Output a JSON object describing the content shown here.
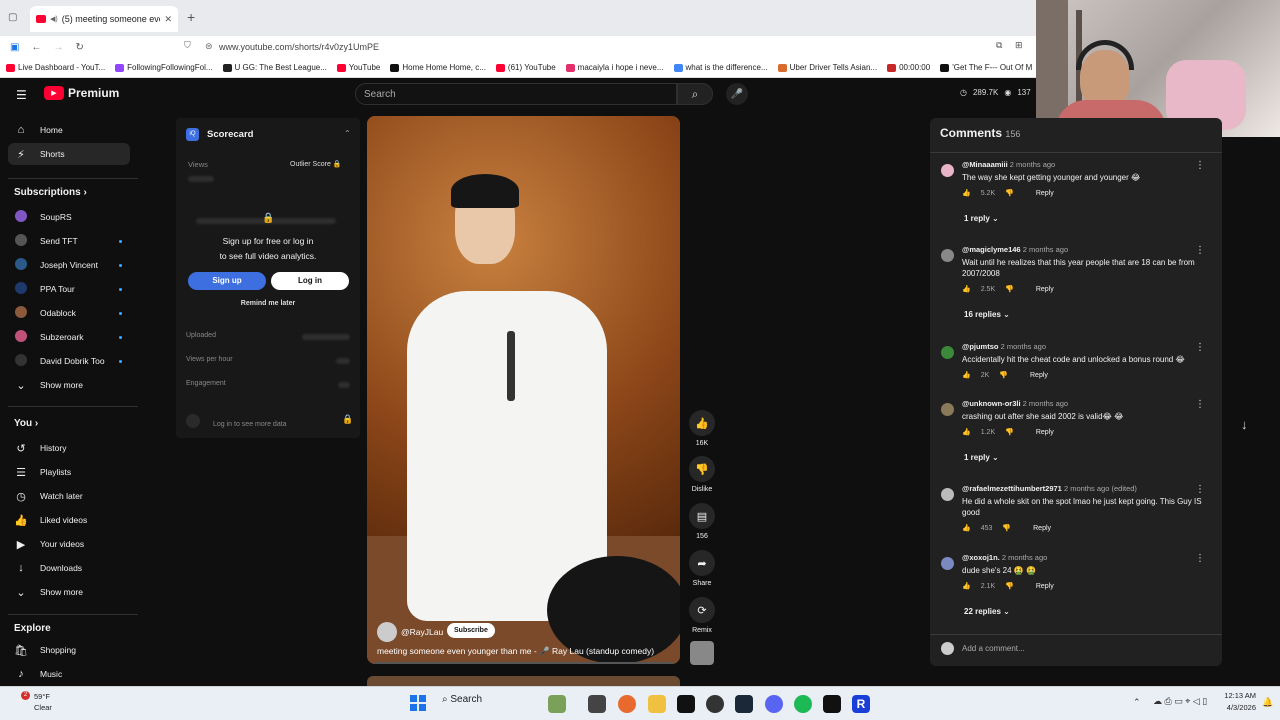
{
  "browser": {
    "tab_title": "(5) meeting someone even",
    "url": "www.youtube.com/shorts/r4v0zy1UmPE",
    "bookmarks": [
      {
        "label": "Live Dashboard - YouT...",
        "color": "#ff0033"
      },
      {
        "label": "FollowingFollowingFol...",
        "color": "#9146ff"
      },
      {
        "label": "U GG: The Best League...",
        "color": "#222222"
      },
      {
        "label": "YouTube",
        "color": "#ff0033"
      },
      {
        "label": "Home Home Home, c...",
        "color": "#111111"
      },
      {
        "label": "(61) YouTube",
        "color": "#ff0033"
      },
      {
        "label": "macaiyla i hope i neve...",
        "color": "#e1306c"
      },
      {
        "label": "what is the difference...",
        "color": "#4285f4"
      },
      {
        "label": "Uber Driver Tells Asian...",
        "color": "#d96c2c"
      },
      {
        "label": "00:00:00",
        "color": "#c62828"
      },
      {
        "label": "'Get The F--- Out Of M",
        "color": "#111111"
      }
    ]
  },
  "header": {
    "logo_text": "Premium",
    "search_placeholder": "Search",
    "stats_views": "289.7K",
    "stats_count": "137"
  },
  "sidebar": {
    "main": [
      {
        "label": "Home",
        "icon": "home-icon"
      },
      {
        "label": "Shorts",
        "icon": "shorts-icon"
      }
    ],
    "subscriptions_title": "Subscriptions",
    "subscriptions": [
      {
        "label": "SoupRS",
        "color": "#7e57c2",
        "dot": false
      },
      {
        "label": "Send TFT",
        "color": "#555555",
        "dot": true
      },
      {
        "label": "Joseph Vincent",
        "color": "#2b5a8a",
        "dot": true
      },
      {
        "label": "PPA Tour",
        "color": "#1e3a6a",
        "dot": true
      },
      {
        "label": "Odablock",
        "color": "#8a5a3a",
        "dot": true
      },
      {
        "label": "Subzeroark",
        "color": "#c0527a",
        "dot": true
      },
      {
        "label": "David Dobrik Too",
        "color": "#333333",
        "dot": true
      }
    ],
    "show_more": "Show more",
    "you_title": "You",
    "you_items": [
      {
        "label": "History",
        "icon": "history-icon"
      },
      {
        "label": "Playlists",
        "icon": "playlists-icon"
      },
      {
        "label": "Watch later",
        "icon": "watch-later-icon"
      },
      {
        "label": "Liked videos",
        "icon": "like-icon"
      },
      {
        "label": "Your videos",
        "icon": "your-videos-icon"
      },
      {
        "label": "Downloads",
        "icon": "download-icon"
      }
    ],
    "show_more_2": "Show more",
    "explore_title": "Explore",
    "explore_items": [
      {
        "label": "Shopping",
        "icon": "shopping-icon"
      },
      {
        "label": "Music",
        "icon": "music-icon"
      }
    ]
  },
  "scorecard": {
    "title": "Scorecard",
    "views_label": "Views",
    "outlier_label": "Outlier Score",
    "signup_text_1": "Sign up for free or log in",
    "signup_text_2": "to see full video analytics.",
    "signup_btn": "Sign up",
    "login_btn": "Log in",
    "remind": "Remind me later",
    "uploaded": "Uploaded",
    "views_per_hour": "Views per hour",
    "engagement": "Engagement",
    "login_more": "Log in to see more data"
  },
  "video": {
    "channel": "@RayJLau",
    "subscribe": "Subscribe",
    "title": "meeting someone even younger than me - 🎤 Ray Lau (standup comedy)",
    "progress": 0.0,
    "likes": "16K",
    "dislike": "Dislike",
    "comments_count": "156",
    "share": "Share",
    "remix": "Remix"
  },
  "comments": {
    "title": "Comments",
    "count": "156",
    "items": [
      {
        "user": "@Minaaamiii",
        "time": "2 months ago",
        "text": "The way she kept getting younger and younger 😂",
        "likes": "5.2K",
        "replies": "1 reply",
        "color": "#e8b4c8"
      },
      {
        "user": "@magiclyme146",
        "time": "2 months ago",
        "text": "Wait until he realizes that this year people that are 18 can be from 2007/2008",
        "likes": "2.5K",
        "replies": "16 replies",
        "color": "#888888"
      },
      {
        "user": "@pjumtso",
        "time": "2 months ago",
        "text": "Accidentally hit the cheat code and unlocked a  bonus round 😂",
        "likes": "2K",
        "replies": "",
        "color": "#3a8a3a"
      },
      {
        "user": "@unknown-or3li",
        "time": "2 months ago",
        "text": "crashing out after she said 2002 is valid😂 😂",
        "likes": "1.2K",
        "replies": "1 reply",
        "color": "#8a7a5a"
      },
      {
        "user": "@rafaelmezettihumbert2971",
        "time": "2 months ago (edited)",
        "text": "He did a whole skit on the spot lmao he just kept going. This Guy IS good",
        "likes": "453",
        "replies": "",
        "color": "#bbbbbb"
      },
      {
        "user": "@xoxoj1n.",
        "time": "2 months ago",
        "text": "dude she's 24 🤮 🤮",
        "likes": "2.1K",
        "replies": "22 replies",
        "color": "#7a8ac0"
      }
    ],
    "reply_label": "Reply",
    "add_comment": "Add a comment..."
  },
  "taskbar": {
    "weather_temp": "59°F",
    "weather_desc": "Clear",
    "weather_badge": "2",
    "search": "Search",
    "time": "12:13 AM",
    "date": "4/3/2026"
  }
}
